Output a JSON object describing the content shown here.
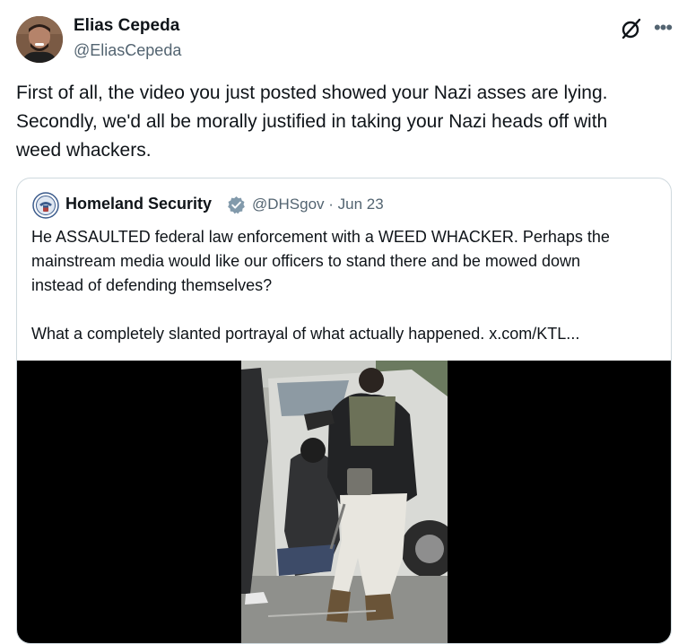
{
  "tweet": {
    "author": {
      "name": "Elias Cepeda",
      "handle": "@EliasCepeda"
    },
    "text_lines": [
      "First of all, the video you just posted showed your Nazi asses are lying.",
      "Secondly, we'd all be morally justified in taking your Nazi heads off with",
      "weed whackers."
    ],
    "quoted": {
      "name": "Homeland Security",
      "handle_date": "@DHSgov · Jun 23",
      "paragraph_1_lines": [
        "He ASSAULTED federal law enforcement with a WEED WHACKER. Perhaps the",
        "mainstream media would like our officers to stand there and be mowed down",
        "instead of defending themselves?"
      ],
      "paragraph_2": "What a completely slanted portrayal of what actually happened.  x.com/KTL...",
      "verified_color": "#829aab"
    }
  },
  "icons": {
    "grok": "grok-icon",
    "more": "more-options-icon",
    "verified": "verified-badge-icon",
    "seal": "dhs-seal-icon"
  },
  "colors": {
    "text_primary": "#0f1419",
    "text_secondary": "#536471",
    "border": "#cfd9de"
  }
}
